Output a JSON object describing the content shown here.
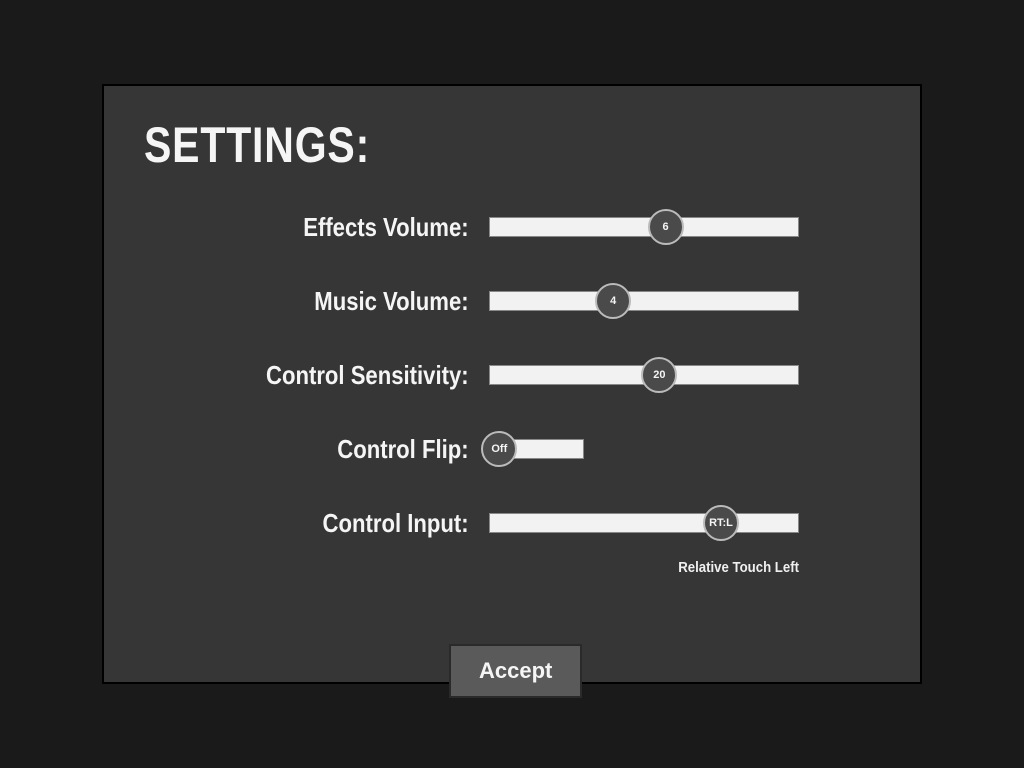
{
  "title": "SETTINGS:",
  "settings": {
    "effects_volume": {
      "label": "Effects Volume:",
      "value": "6",
      "pos_pct": 57
    },
    "music_volume": {
      "label": "Music Volume:",
      "value": "4",
      "pos_pct": 40
    },
    "control_sensitivity": {
      "label": "Control Sensitivity:",
      "value": "20",
      "pos_pct": 55
    },
    "control_flip": {
      "label": "Control Flip:",
      "value": "Off",
      "pos_pct": 10
    },
    "control_input": {
      "label": "Control Input:",
      "value": "RT:L",
      "pos_pct": 75,
      "caption": "Relative Touch Left"
    }
  },
  "accept": {
    "label": "Accept"
  }
}
